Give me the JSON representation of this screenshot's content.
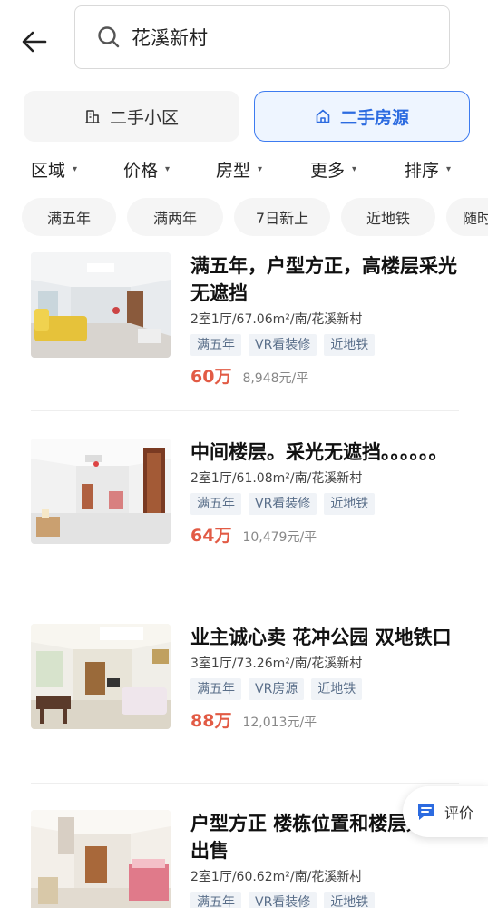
{
  "search": {
    "query": "花溪新村"
  },
  "type_tabs": [
    {
      "label": "二手小区",
      "active": false
    },
    {
      "label": "二手房源",
      "active": true
    }
  ],
  "filters": [
    "区域",
    "价格",
    "房型",
    "更多",
    "排序"
  ],
  "chips": [
    "满五年",
    "满两年",
    "7日新上",
    "近地铁",
    "随时"
  ],
  "listings": [
    {
      "title": "满五年，户型方正，高楼层采光无遮挡",
      "meta": "2室1厅/67.06m²/南/花溪新村",
      "tags": [
        "满五年",
        "VR看装修",
        "近地铁"
      ],
      "price": "60万",
      "unit_price": "8,948元/平"
    },
    {
      "title": "中间楼层。采光无遮挡。。。。。。",
      "meta": "2室1厅/61.08m²/南/花溪新村",
      "tags": [
        "满五年",
        "VR看装修",
        "近地铁"
      ],
      "price": "64万",
      "unit_price": "10,479元/平"
    },
    {
      "title": "业主诚心卖 花冲公园 双地铁口",
      "meta": "3室1厅/73.26m²/南/花溪新村",
      "tags": [
        "满五年",
        "VR房源",
        "近地铁"
      ],
      "price": "88万",
      "unit_price": "12,013元/平"
    },
    {
      "title": "户型方正  楼栋位置和楼层好 诚心出售",
      "meta": "2室1厅/60.62m²/南/花溪新村",
      "tags": [
        "满五年",
        "VR看装修",
        "近地铁"
      ],
      "price": "",
      "unit_price": ""
    }
  ],
  "review_button": {
    "label": "评价"
  },
  "colors": {
    "accent": "#2c6be0",
    "price": "#e25b45",
    "tag_text": "#5a6f8a"
  }
}
